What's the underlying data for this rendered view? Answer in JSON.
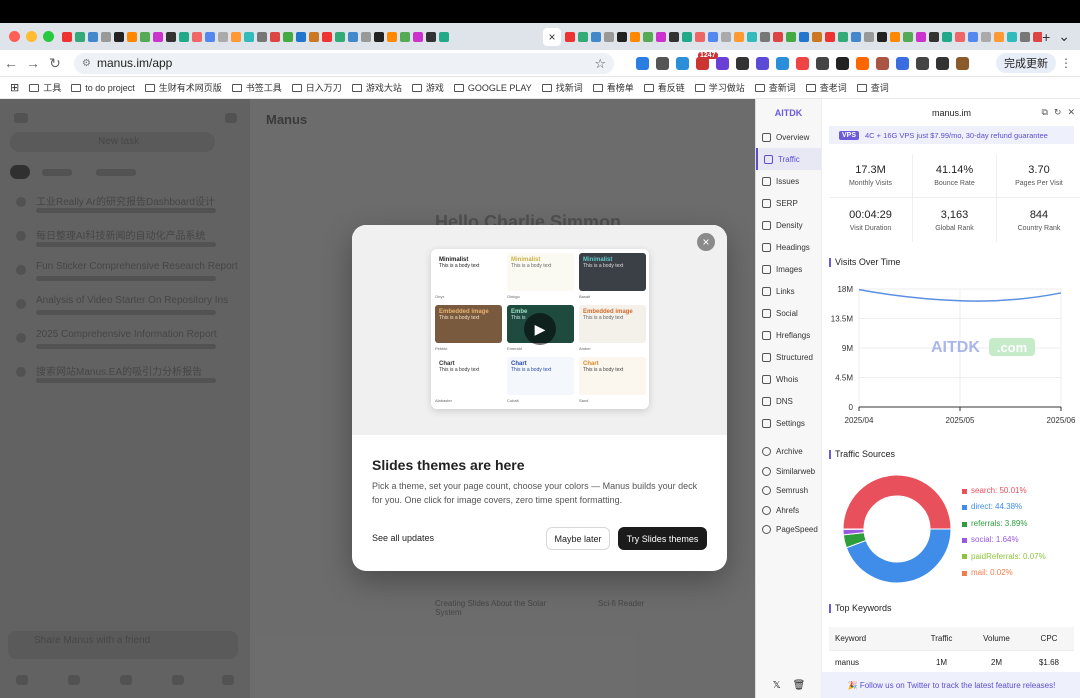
{
  "browser": {
    "tab_close": "×",
    "tab_new": "+",
    "url": "manus.im/app",
    "update_button": "完成更新",
    "ext_badge": "1247",
    "bookmarks": [
      {
        "label": "工具"
      },
      {
        "label": "to do project"
      },
      {
        "label": "生财有术网页版"
      },
      {
        "label": "书签工具"
      },
      {
        "label": "日入万刀"
      },
      {
        "label": "游戏大站"
      },
      {
        "label": "游戏"
      },
      {
        "label": "GOOGLE PLAY"
      },
      {
        "label": "找新词"
      },
      {
        "label": "看榜单"
      },
      {
        "label": "看反链"
      },
      {
        "label": "学习做站"
      },
      {
        "label": "查新词"
      },
      {
        "label": "查老词"
      },
      {
        "label": "查词"
      }
    ]
  },
  "app": {
    "new_task": "New task",
    "brand": "Manus",
    "greeting": "Hello Charlie Simmon",
    "history": [
      "工业Really Ar的研究报告Dashboard设计",
      "每日整理AI科技新闻的自动化产品系统",
      "Fun Sticker Comprehensive Research Report",
      "Analysis of Video Starter On Repository Ins",
      "2025 Comprehensive Information Report",
      "搜索网站Manus.EA的吸引力分析报告"
    ],
    "share": "Share Manus with a friend",
    "cards": [
      "Creating Slides About the Solar System",
      "Sci-fi Reader"
    ]
  },
  "modal": {
    "close": "×",
    "title": "Slides themes are here",
    "description": "Pick a theme, set your page count, choose your colors — Manus builds your deck for you. One click for image covers, zero time spent formatting.",
    "see_all": "See all updates",
    "later": "Maybe later",
    "try": "Try Slides themes",
    "play": "▶",
    "themes": [
      {
        "title": "Minimalist",
        "body": "This is a body text",
        "label": "Onyx",
        "bg": "#ffffff",
        "fg": "#222222",
        "accent": "#222222"
      },
      {
        "title": "Minimalist",
        "body": "This is a body text",
        "label": "Ginkgo",
        "bg": "#fbfaf2",
        "fg": "#666666",
        "accent": "#c9b14a"
      },
      {
        "title": "Minimalist",
        "body": "This is a body text",
        "label": "Basalt",
        "bg": "#3b4046",
        "fg": "#dddddd",
        "accent": "#5ec8c8"
      },
      {
        "title": "Embedded image",
        "body": "This is a body text",
        "label": "Pebble",
        "bg": "#7a5a3f",
        "fg": "#f2e2c8",
        "accent": "#e8b36b"
      },
      {
        "title": "Embe",
        "body": "This is",
        "label": "Emerald",
        "bg": "#1f4a3e",
        "fg": "#cfe6dc",
        "accent": "#9fe0c4"
      },
      {
        "title": "Embedded image",
        "body": "This is a body text",
        "label": "Amber",
        "bg": "#f4f1ea",
        "fg": "#666666",
        "accent": "#d56a2a"
      },
      {
        "title": "Chart",
        "body": "This is a body text",
        "label": "Alabaster",
        "bg": "#ffffff",
        "fg": "#333333",
        "accent": "#333333"
      },
      {
        "title": "Chart",
        "body": "This is a body text",
        "label": "Cobalt",
        "bg": "#f4f7fc",
        "fg": "#2a4aa8",
        "accent": "#2a4aa8"
      },
      {
        "title": "Chart",
        "body": "This is a body text",
        "label": "Sand",
        "bg": "#fbf7ef",
        "fg": "#444444",
        "accent": "#e08a2c"
      }
    ]
  },
  "panel": {
    "brand": "AITDK",
    "domain": "manus.im",
    "promo_tag": "VPS",
    "promo_text": "4C + 16G VPS just $7.99/mo, 30-day refund guarantee",
    "nav": [
      {
        "label": "Overview",
        "active": false
      },
      {
        "label": "Traffic",
        "active": true
      },
      {
        "label": "Issues",
        "active": false
      },
      {
        "label": "SERP",
        "active": false
      },
      {
        "label": "Density",
        "active": false
      },
      {
        "label": "Headings",
        "active": false
      },
      {
        "label": "Images",
        "active": false
      },
      {
        "label": "Links",
        "active": false
      },
      {
        "label": "Social",
        "active": false
      },
      {
        "label": "Hreflangs",
        "active": false
      },
      {
        "label": "Structured",
        "active": false
      },
      {
        "label": "Whois",
        "active": false
      },
      {
        "label": "DNS",
        "active": false
      },
      {
        "label": "Settings",
        "active": false
      }
    ],
    "tools": [
      {
        "label": "Archive"
      },
      {
        "label": "Similarweb"
      },
      {
        "label": "Semrush"
      },
      {
        "label": "Ahrefs"
      },
      {
        "label": "PageSpeed"
      }
    ],
    "metrics": [
      {
        "value": "17.3M",
        "label": "Monthly Visits"
      },
      {
        "value": "41.14%",
        "label": "Bounce Rate"
      },
      {
        "value": "3.70",
        "label": "Pages Per Visit"
      },
      {
        "value": "00:04:29",
        "label": "Visit Duration"
      },
      {
        "value": "3,163",
        "label": "Global Rank"
      },
      {
        "value": "844",
        "label": "Country Rank"
      }
    ],
    "visits_title": "Visits Over Time",
    "sources_title": "Traffic Sources",
    "keywords_title": "Top Keywords",
    "watermark_a": "AITDK",
    "watermark_b": ".com",
    "keyword_headers": [
      "Keyword",
      "Traffic",
      "Volume",
      "CPC"
    ],
    "keywords": [
      {
        "keyword": "manus",
        "traffic": "1M",
        "volume": "2M",
        "cpc": "$1.68"
      }
    ],
    "footer": "🎉 Follow us on Twitter to track the latest feature releases!"
  },
  "chart_data": [
    {
      "type": "line",
      "title": "Visits Over Time",
      "x": [
        "2025/04",
        "2025/05",
        "2025/06"
      ],
      "series": [
        {
          "values": [
            17.9,
            16.2,
            17.4
          ]
        }
      ],
      "y_ticks": [
        "0",
        "4.5M",
        "9M",
        "13.5M",
        "18M"
      ],
      "ylim": [
        0,
        18
      ],
      "grid": true,
      "color": "#5b8fe0"
    },
    {
      "type": "pie",
      "title": "Traffic Sources",
      "labels": [
        "search: 50.01%",
        "direct: 44.38%",
        "referrals: 3.89%",
        "social: 1.64%",
        "paidReferrals: 0.07%",
        "mail: 0.02%"
      ],
      "values": [
        50.01,
        44.38,
        3.89,
        1.64,
        0.07,
        0.02
      ],
      "colors": [
        "#e8515b",
        "#3f8de8",
        "#2e9e3d",
        "#9a57e0",
        "#8cc43c",
        "#ef7f4a"
      ],
      "donut": true,
      "legend": "right"
    }
  ]
}
